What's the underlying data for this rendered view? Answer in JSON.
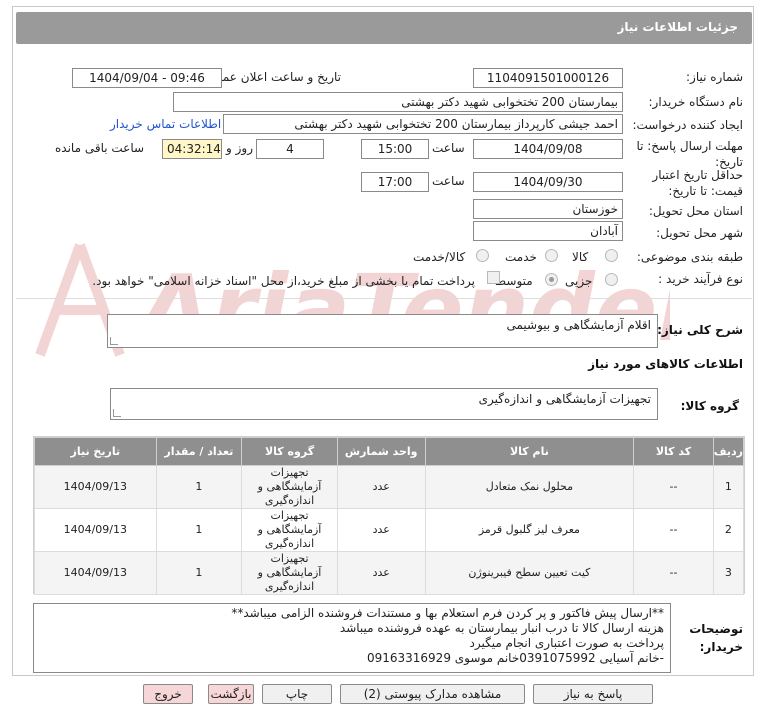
{
  "header": {
    "title": "جزئیات اطلاعات نیاز"
  },
  "form": {
    "need_number_label": "شماره نیاز:",
    "need_number": "1104091501000126",
    "announce_label": "تاریخ و ساعت اعلان عمومی:",
    "announce_value": "1404/09/04 - 09:46",
    "buyer_org_label": "نام دستگاه خریدار:",
    "buyer_org": "بیمارستان 200 تختخوابی شهید دکتر بهشتی",
    "creator_label": "ایجاد کننده درخواست:",
    "creator": "احمد جیشی کارپرداز بیمارستان 200 تختخوابی شهید دکتر بهشتی",
    "contact_link": "اطلاعات تماس خریدار",
    "deadline_label": "مهلت ارسال پاسخ: تا تاریخ:",
    "deadline_date": "1404/09/08",
    "time_label": "ساعت",
    "deadline_time": "15:00",
    "days_value": "4",
    "days_label": "روز و",
    "remaining_time": "04:32:14",
    "remaining_label": "ساعت باقی مانده",
    "validity_label": "حداقل تاریخ اعتبار قیمت: تا تاریخ:",
    "validity_date": "1404/09/30",
    "validity_time": "17:00",
    "province_label": "استان محل تحویل:",
    "province": "خوزستان",
    "city_label": "شهر محل تحویل:",
    "city": "آبادان",
    "category_label": "طبقه بندی موضوعی:",
    "category_options": [
      "کالا",
      "خدمت",
      "کالا/خدمت"
    ],
    "process_label": "نوع فرآیند خرید :",
    "process_options": [
      "جزیی",
      "متوسط"
    ],
    "payment_note": "پرداخت تمام یا بخشی از مبلغ خرید،از محل \"اسناد خزانه اسلامی\" خواهد بود."
  },
  "description": {
    "label": "شرح کلی نیاز:",
    "value": "اقلام آزمایشگاهی و بیوشیمی"
  },
  "goods_section_title": "اطلاعات کالاهای مورد نیاز",
  "goods_group": {
    "label": "گروه کالا:",
    "value": "تجهیزات آزمایشگاهی و اندازه‌گیری"
  },
  "table": {
    "headers": [
      "ردیف",
      "کد کالا",
      "نام کالا",
      "واحد شمارش",
      "گروه کالا",
      "تعداد / مقدار",
      "تاریخ نیاز"
    ],
    "rows": [
      {
        "index": "1",
        "code": "--",
        "name": "محلول نمک متعادل",
        "unit": "عدد",
        "group": "تجهیزات آزمایشگاهی و اندازه‌گیری",
        "qty": "1",
        "date": "1404/09/13"
      },
      {
        "index": "2",
        "code": "--",
        "name": "معرف لیز گلبول قرمز",
        "unit": "عدد",
        "group": "تجهیزات آزمایشگاهی و اندازه‌گیری",
        "qty": "1",
        "date": "1404/09/13"
      },
      {
        "index": "3",
        "code": "--",
        "name": "کیت تعیین سطح فیبرینوژن",
        "unit": "عدد",
        "group": "تجهیزات آزمایشگاهی و اندازه‌گیری",
        "qty": "1",
        "date": "1404/09/13"
      }
    ]
  },
  "buyer_notes": {
    "label": "توضیحات خریدار:",
    "lines": [
      "**ارسال پیش فاکتور و پر کردن فرم استعلام بها  و مستندات فروشنده الزامی میباشد**",
      "هزینه ارسال کالا تا درب انبار بیمارستان به عهده فروشنده میباشد",
      "پرداخت به صورت اعتباری انجام میگیرد",
      "-خانم آسیایی 0391075992خانم موسوی 09163316929"
    ]
  },
  "buttons": {
    "reply": "پاسخ به نیاز",
    "attachments": "مشاهده مدارک پیوستی (2)",
    "print": "چاپ",
    "back": "بازگشت",
    "exit": "خروج"
  },
  "watermark_text": "AriaTender.net"
}
